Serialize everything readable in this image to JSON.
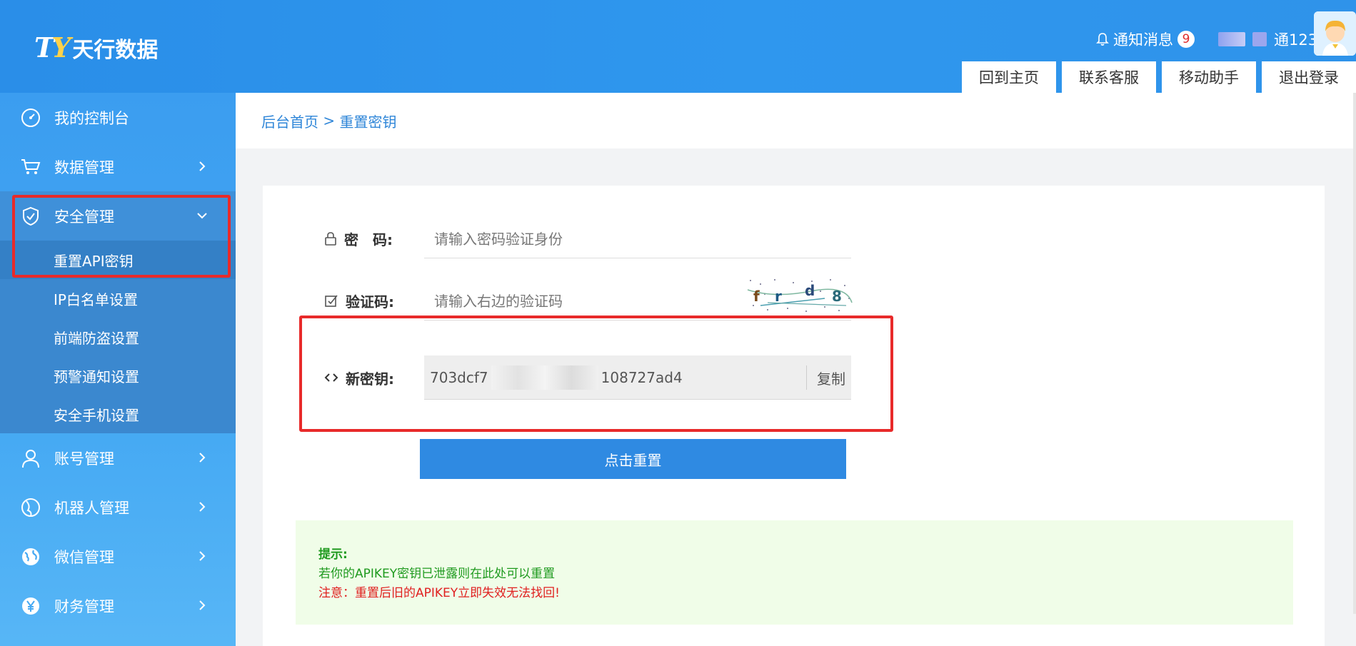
{
  "header": {
    "logo_mark": "TY",
    "logo_text": "天行数据",
    "notify_label": "通知消息",
    "notify_count": "9",
    "username": "通123",
    "tabs": [
      "回到主页",
      "联系客服",
      "移动助手",
      "退出登录"
    ]
  },
  "sidebar": {
    "items": [
      {
        "label": "我的控制台",
        "icon": "dashboard-icon"
      },
      {
        "label": "数据管理",
        "icon": "cart-icon"
      },
      {
        "label": "安全管理",
        "icon": "shield-icon"
      },
      {
        "label": "账号管理",
        "icon": "user-icon"
      },
      {
        "label": "机器人管理",
        "icon": "globe-icon"
      },
      {
        "label": "微信管理",
        "icon": "earth-icon"
      },
      {
        "label": "财务管理",
        "icon": "yen-icon"
      }
    ],
    "security_sub": [
      "重置API密钥",
      "IP白名单设置",
      "前端防盗设置",
      "预警通知设置",
      "安全手机设置"
    ]
  },
  "breadcrumb": {
    "home": "后台首页",
    "sep": " > ",
    "current": "重置密钥"
  },
  "form": {
    "password_label": "密　码:",
    "password_placeholder": "请输入密码验证身份",
    "captcha_label": "验证码:",
    "captcha_placeholder": "请输入右边的验证码",
    "captcha_text": "f r d 8",
    "newkey_label": "新密钥:",
    "newkey_start": "703dcf7",
    "newkey_end": "108727ad4",
    "copy_label": "复制",
    "reset_label": "点击重置"
  },
  "tips": {
    "title": "提示:",
    "line1": "若你的APIKEY密钥已泄露则在此处可以重置",
    "line2": "注意：重置后旧的APIKEY立即失效无法找回!"
  },
  "colors": {
    "header": "#2f93ea",
    "sidebar": "#45a9f3",
    "button": "#2f8ae2",
    "highlight": "#e82a2a",
    "tip_green": "#1f9a1f",
    "tip_red": "#e02020"
  }
}
